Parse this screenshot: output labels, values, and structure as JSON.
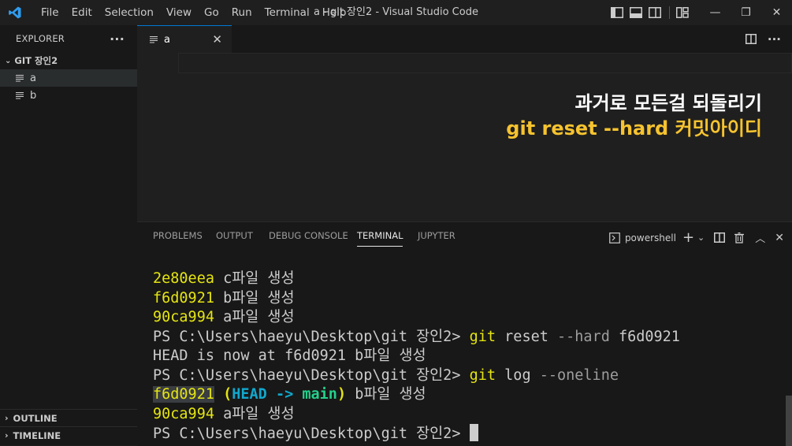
{
  "titlebar": {
    "menus": [
      "File",
      "Edit",
      "Selection",
      "View",
      "Go",
      "Run",
      "Terminal",
      "Help"
    ],
    "title": "a - git 장인2 - Visual Studio Code"
  },
  "sidebar": {
    "header": "EXPLORER",
    "more": "···",
    "folder": "GIT 장인2",
    "files": [
      {
        "name": "a",
        "active": true
      },
      {
        "name": "b",
        "active": false
      }
    ],
    "outline": "OUTLINE",
    "timeline": "TIMELINE"
  },
  "tabs": [
    {
      "label": "a"
    }
  ],
  "overlay": {
    "line1": "과거로 모든걸 되돌리기",
    "line2": "git reset --hard 커밋아이디"
  },
  "panel": {
    "tabs": [
      "PROBLEMS",
      "OUTPUT",
      "DEBUG CONSOLE",
      "TERMINAL",
      "JUPYTER"
    ],
    "active_tab": "TERMINAL",
    "shell": "powershell"
  },
  "terminal": {
    "log1": [
      {
        "hash": "2e80eea",
        "msg": "c파일 생성"
      },
      {
        "hash": "f6d0921",
        "msg": "b파일 생성"
      },
      {
        "hash": "90ca994",
        "msg": "a파일 생성"
      }
    ],
    "prompt": "PS C:\\Users\\haeyu\\Desktop\\git 장인2>",
    "cmd1": {
      "git": "git",
      "sub": "reset",
      "flag": "--hard",
      "arg": "f6d0921"
    },
    "head_line": "HEAD is now at f6d0921 b파일 생성",
    "cmd2": {
      "git": "git",
      "sub": "log",
      "flag": "--oneline"
    },
    "log2": {
      "hash1": "f6d0921",
      "head": "HEAD",
      "arrow": "->",
      "branch": "main",
      "msg1": "b파일 생성",
      "hash2": "90ca994",
      "msg2": "a파일 생성"
    }
  },
  "colors": {
    "accent": "#0078d4",
    "overlay_highlight": "#f6c32f",
    "hash_yellow": "#e5e510",
    "head_cyan": "#11a8cd",
    "branch_green": "#23d18b"
  }
}
